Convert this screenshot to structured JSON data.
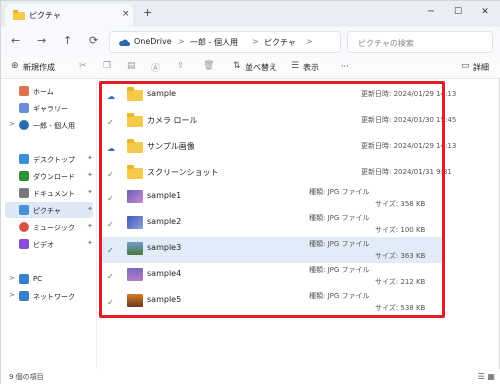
{
  "tab": {
    "title": "ピクチャ",
    "close": "×",
    "new": "+"
  },
  "window": {
    "minimize": "─",
    "maximize": "☐",
    "close": "✕"
  },
  "nav": {
    "back": "←",
    "forward": "→",
    "up": "↑",
    "refresh": "⟳"
  },
  "breadcrumb": [
    "OneDrive",
    "一郎 - 個人用",
    "ピクチャ"
  ],
  "search": {
    "placeholder": "ピクチャの検索"
  },
  "command": {
    "new": "新規作成",
    "sort": "並べ替え",
    "view": "表示",
    "more": "···",
    "details": "詳細"
  },
  "sidebar": {
    "items": [
      {
        "label": "ホーム",
        "icon": "home-icon"
      },
      {
        "label": "ギャラリー",
        "icon": "gallery-icon"
      },
      {
        "label": "一郎 - 個人用",
        "icon": "cloud-icon"
      },
      {
        "label": "デスクトップ",
        "icon": "desktop-icon"
      },
      {
        "label": "ダウンロード",
        "icon": "download-icon"
      },
      {
        "label": "ドキュメント",
        "icon": "document-icon"
      },
      {
        "label": "ピクチャ",
        "icon": "pictures-icon"
      },
      {
        "label": "ミュージック",
        "icon": "music-icon"
      },
      {
        "label": "ビデオ",
        "icon": "video-icon"
      },
      {
        "label": "PC",
        "icon": "pc-icon"
      },
      {
        "label": "ネットワーク",
        "icon": "network-icon"
      }
    ]
  },
  "files": [
    {
      "name": "sample",
      "type": "folder",
      "status": "cloud",
      "modified": "更新日時: 2024/01/29 14:13"
    },
    {
      "name": "カメラ ロール",
      "type": "folder",
      "status": "check",
      "modified": "更新日時: 2024/01/30 15:45"
    },
    {
      "name": "サンプル画像",
      "type": "folder",
      "status": "cloud",
      "modified": "更新日時: 2024/01/29 14:13"
    },
    {
      "name": "スクリーンショット",
      "type": "folder",
      "status": "check",
      "modified": "更新日時: 2024/01/31 9:31"
    },
    {
      "name": "sample1",
      "type": "image",
      "status": "check",
      "kind": "種類: JPG ファイル",
      "size": "サイズ: 358 KB"
    },
    {
      "name": "sample2",
      "type": "image",
      "status": "check",
      "kind": "種類: JPG ファイル",
      "size": "サイズ: 100 KB"
    },
    {
      "name": "sample3",
      "type": "image",
      "status": "check",
      "kind": "種類: JPG ファイル",
      "size": "サイズ: 363 KB"
    },
    {
      "name": "sample4",
      "type": "image",
      "status": "check",
      "kind": "種類: JPG ファイル",
      "size": "サイズ: 212 KB"
    },
    {
      "name": "sample5",
      "type": "image",
      "status": "check",
      "kind": "種類: JPG ファイル",
      "size": "サイズ: 538 KB"
    }
  ],
  "statusbar": {
    "count": "9 個の項目"
  },
  "colors": {
    "highlight": "#e51c23",
    "accent": "#2b6cb0"
  }
}
